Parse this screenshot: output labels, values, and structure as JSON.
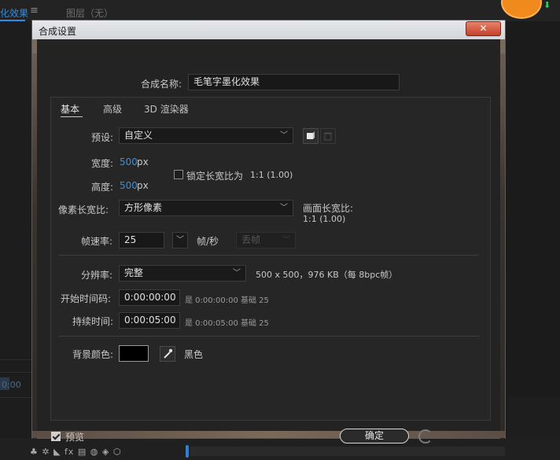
{
  "app": {
    "active_tab": "化效果",
    "menu_icon": "≡",
    "other_tab": "图层（无）",
    "left_time": "0:00"
  },
  "dialog": {
    "title": "合成设置",
    "close_glyph": "✕",
    "comp_name_label": "合成名称:",
    "comp_name_value": "毛笔字墨化效果",
    "tabs": [
      {
        "label": "基本"
      },
      {
        "label": "高级"
      },
      {
        "label": "3D 渲染器"
      }
    ],
    "preset": {
      "label": "预设:",
      "value": "自定义"
    },
    "width": {
      "label": "宽度:",
      "value": "500",
      "unit": "px"
    },
    "height": {
      "label": "高度:",
      "value": "500",
      "unit": "px"
    },
    "lock_aspect": {
      "label": "锁定长宽比为",
      "ratio": "1:1 (1.00)",
      "checked": false
    },
    "pixel_aspect": {
      "label": "像素长宽比:",
      "value": "方形像素"
    },
    "frame_aspect": {
      "label": "画面长宽比:",
      "value": "1:1 (1.00)"
    },
    "frame_rate": {
      "label": "帧速率:",
      "value": "25",
      "unit": "帧/秒",
      "drop_frame": "丢帧"
    },
    "resolution": {
      "label": "分辨率:",
      "value": "完整",
      "info": "500 x 500，976 KB（每 8bpc帧）"
    },
    "start_time": {
      "label": "开始时间码:",
      "value": "0:00:00:00",
      "info": "是 0:00:00:00  基础 25"
    },
    "duration": {
      "label": "持续时间:",
      "value": "0:00:05:00",
      "info": "是 0:00:05:00  基础 25"
    },
    "background": {
      "label": "背景颜色:",
      "color": "#000000",
      "name": "黑色"
    },
    "preview": {
      "label": "预览",
      "checked": true
    },
    "ok_label": "确定"
  },
  "bottom_tools": "♣ ✲ ◣ fx ▤ ◍ ◈ ⬡",
  "colors": {
    "accent": "#2d8ceb",
    "badge": "#f08a1c"
  }
}
